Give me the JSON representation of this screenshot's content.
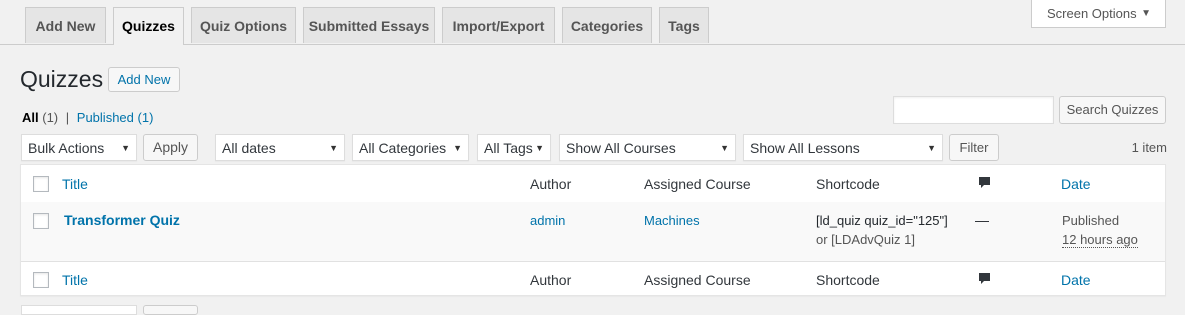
{
  "tabs": [
    {
      "label": "Add New"
    },
    {
      "label": "Quizzes"
    },
    {
      "label": "Quiz Options"
    },
    {
      "label": "Submitted Essays"
    },
    {
      "label": "Import/Export"
    },
    {
      "label": "Categories"
    },
    {
      "label": "Tags"
    }
  ],
  "screen_options": {
    "label": "Screen Options",
    "caret": "▼"
  },
  "page": {
    "title": "Quizzes",
    "add_new": "Add New"
  },
  "filters_views": {
    "all": "All",
    "all_count": "(1)",
    "separator": "|",
    "published": "Published",
    "published_count": "(1)"
  },
  "search": {
    "placeholder": "",
    "button": "Search Quizzes"
  },
  "bulk": {
    "selected": "Bulk Actions",
    "apply": "Apply"
  },
  "dropdowns": {
    "dates": "All dates",
    "categories": "All Categories",
    "tags": "All Tags",
    "courses": "Show All Courses",
    "lessons": "Show All Lessons"
  },
  "filter_button": "Filter",
  "items_count": "1 item",
  "columns": {
    "title": "Title",
    "author": "Author",
    "assigned_course": "Assigned Course",
    "shortcode": "Shortcode",
    "date": "Date"
  },
  "rows": [
    {
      "title": "Transformer Quiz",
      "author": "admin",
      "course": "Machines",
      "shortcode_line1": "[ld_quiz quiz_id=\"125\"]",
      "shortcode_line2": "or [LDAdvQuiz 1]",
      "comments": "—",
      "status": "Published",
      "date": "12 hours ago"
    }
  ],
  "icons": {
    "dropdown_arrow": "▼",
    "comment": "comment-bubble-icon"
  }
}
